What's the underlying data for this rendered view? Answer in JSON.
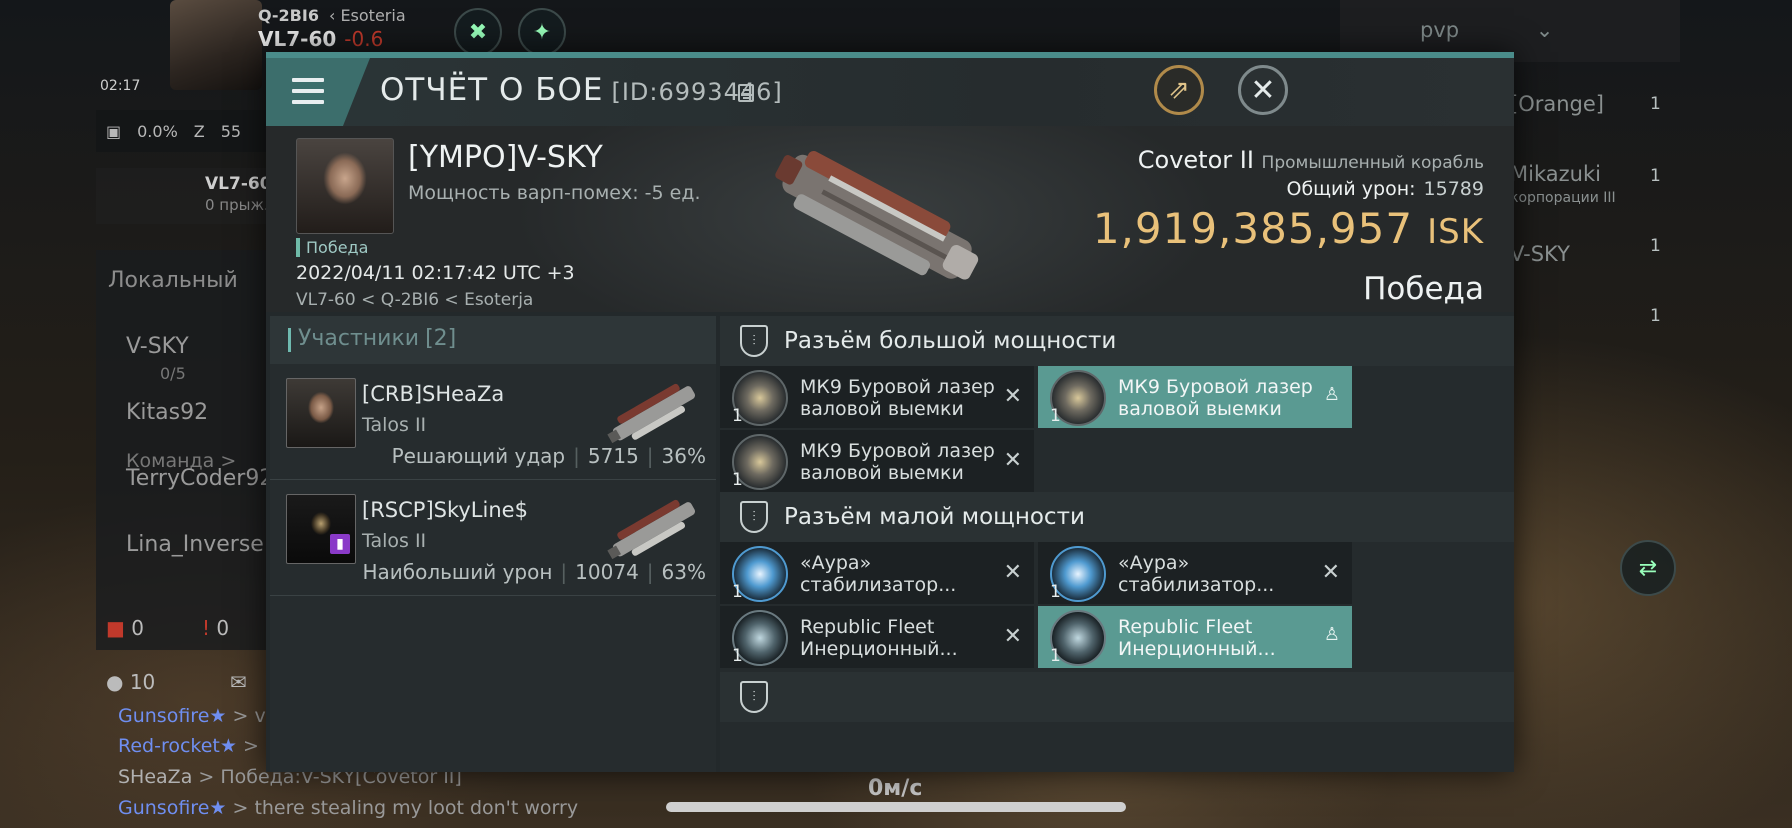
{
  "background": {
    "location_top": "Q-2BI6",
    "location_region": "Esoteria",
    "system": "VL7-60",
    "security": "-0.6",
    "clock": "02:17",
    "stat_a": "0.0%",
    "stat_b": "55",
    "nav_system": "VL7-60",
    "nav_sub": "0 прыж.",
    "channel": "Локальный",
    "members": [
      "V-SKY",
      "Kitas92",
      "TerryCoder92",
      "Lina_Inverse"
    ],
    "member_sub_a": "0/5",
    "member_sub_b": "Команда >",
    "count_red": "0",
    "count_warn": "0",
    "online_count": "10",
    "chat": [
      {
        "name": "Gunsofire",
        "text": "> vi"
      },
      {
        "name": "Red-rocket",
        "text": ">"
      },
      {
        "name": "SHeaZa",
        "text": "> Победа:V-SKY[Covetor II]"
      },
      {
        "name": "Gunsofire",
        "text": "> there stealing my loot don't worry"
      }
    ],
    "filter_label": "pvp",
    "right_rows": [
      "[Orange]",
      "Mikazuki",
      "корпорации III",
      "V-SKY"
    ],
    "right_badges": [
      "1",
      "1",
      "1",
      "1"
    ],
    "speed": "0м/с"
  },
  "report": {
    "title": "ОТЧЁТ О БОЕ",
    "id": "[ID:6993446]",
    "victim": {
      "name": "[YMPO]V-SKY",
      "warp": "Мощность варп-помех: -5 ед.",
      "result_tag": "Победа",
      "date": "2022/04/11 02:17:42 UTC +3",
      "route": "VL7-60 < Q-2BI6 < Esoterja",
      "ship": "Covetor II",
      "ship_class": "Промышленный корабль",
      "damage_label": "Общий урон:",
      "damage_value": "15789",
      "isk_value": "1,919,385,957",
      "isk_currency": "ISK",
      "outcome": "Победа"
    },
    "participants": {
      "label": "Участники",
      "count": "[2]",
      "list": [
        {
          "name": "[CRB]SHeaZa",
          "ship": "Talos II",
          "role": "Решающий удар",
          "damage": "5715",
          "percent": "36%"
        },
        {
          "name": "[RSCP]SkyLine$",
          "ship": "Talos II",
          "role": "Наибольший урон",
          "damage": "10074",
          "percent": "63%"
        }
      ]
    },
    "high_slots": {
      "title": "Разъём большой мощности",
      "modules": [
        {
          "name": "МК9 Буровой лазер валовой выемки",
          "qty": "1",
          "highlight": false
        },
        {
          "name": "МК9 Буровой лазер валовой выемки",
          "qty": "1",
          "highlight": true
        },
        {
          "name": "МК9 Буровой лазер валовой выемки",
          "qty": "1",
          "highlight": false
        }
      ]
    },
    "low_slots": {
      "title": "Разъём малой мощности",
      "modules": [
        {
          "name": "«Аура» стабилизатор...",
          "qty": "1",
          "highlight": false
        },
        {
          "name": "«Аура» стабилизатор...",
          "qty": "1",
          "highlight": false
        },
        {
          "name": "Republic Fleet Инерционный...",
          "qty": "1",
          "highlight": false
        },
        {
          "name": "Republic Fleet Инерционный...",
          "qty": "1",
          "highlight": true
        }
      ]
    }
  }
}
